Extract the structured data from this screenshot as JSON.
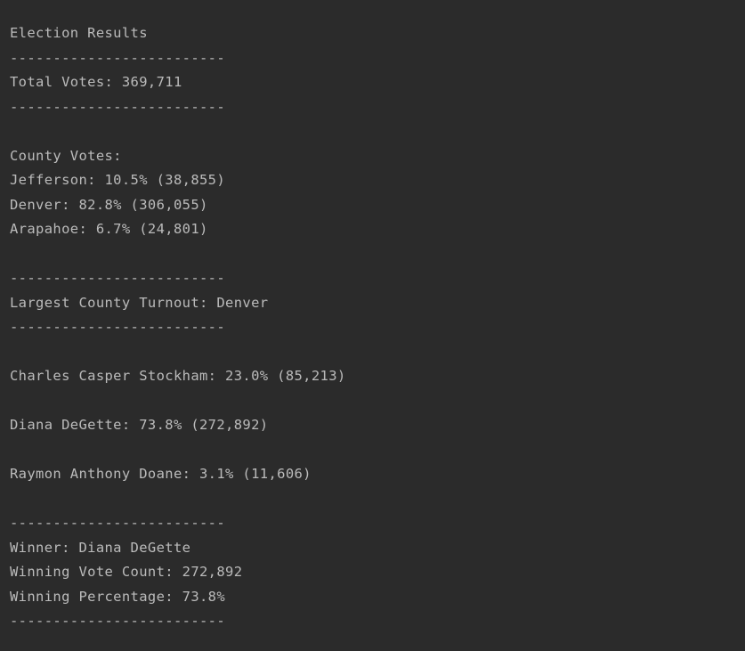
{
  "output": {
    "title": "Election Results",
    "separator": "-------------------------",
    "total_votes": "Total Votes: 369,711",
    "county_header": "County Votes:",
    "counties": [
      "Jefferson: 10.5% (38,855)",
      "Denver: 82.8% (306,055)",
      "Arapahoe: 6.7% (24,801)"
    ],
    "largest_county": "Largest County Turnout: Denver",
    "candidates": [
      "Charles Casper Stockham: 23.0% (85,213)",
      "Diana DeGette: 73.8% (272,892)",
      "Raymon Anthony Doane: 3.1% (11,606)"
    ],
    "winner": "Winner: Diana DeGette",
    "winning_vote_count": "Winning Vote Count: 272,892",
    "winning_percentage": "Winning Percentage: 73.8%"
  },
  "colors": {
    "background": "#2b2b2b",
    "text": "#bbbbbb"
  }
}
